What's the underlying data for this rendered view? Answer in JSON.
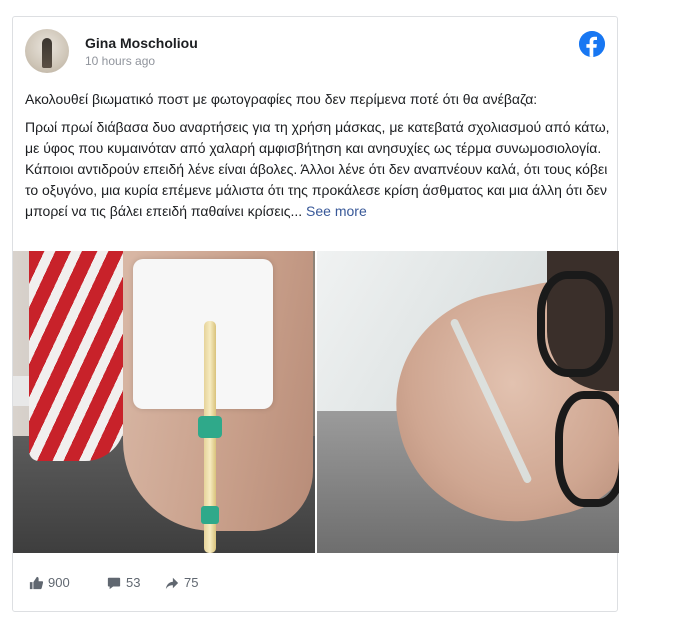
{
  "post": {
    "author": "Gina Moscholiou",
    "time": "10 hours ago",
    "intro": "Ακολουθεί βιωματικό ποστ με φωτογραφίες που δεν περίμενα ποτέ ότι θα ανέβαζα:",
    "body": "Πρωί πρωί διάβασα δυο αναρτήσεις για τη χρήση μάσκας, με κατεβατά σχολιασμού από κάτω, με ύφος που κυμαινόταν από χαλαρή αμφισβήτηση και ανησυχίες ως τέρμα συνωμοσιολογία. Κάποιοι αντιδρούν επειδή λένε είναι άβολες. Άλλοι λένε ότι δεν αναπνέουν καλά, ότι τους κόβει το οξυγόνο, μια κυρία επέμενε μάλιστα ότι της προκάλεσε κρίση άσθματος και μια άλλη ότι δεν μπορεί να τις βάλει επειδή παθαίνει κρίσεις...",
    "see_more": "See more"
  },
  "icons": {
    "platform": "facebook-icon",
    "likes": "thumbs-up-icon",
    "comments": "comment-icon",
    "shares": "share-arrow-icon"
  },
  "stats": {
    "likes": "900",
    "comments": "53",
    "shares": "75"
  },
  "colors": {
    "facebook_blue": "#1877f2",
    "link": "#385898",
    "muted": "#606770"
  }
}
